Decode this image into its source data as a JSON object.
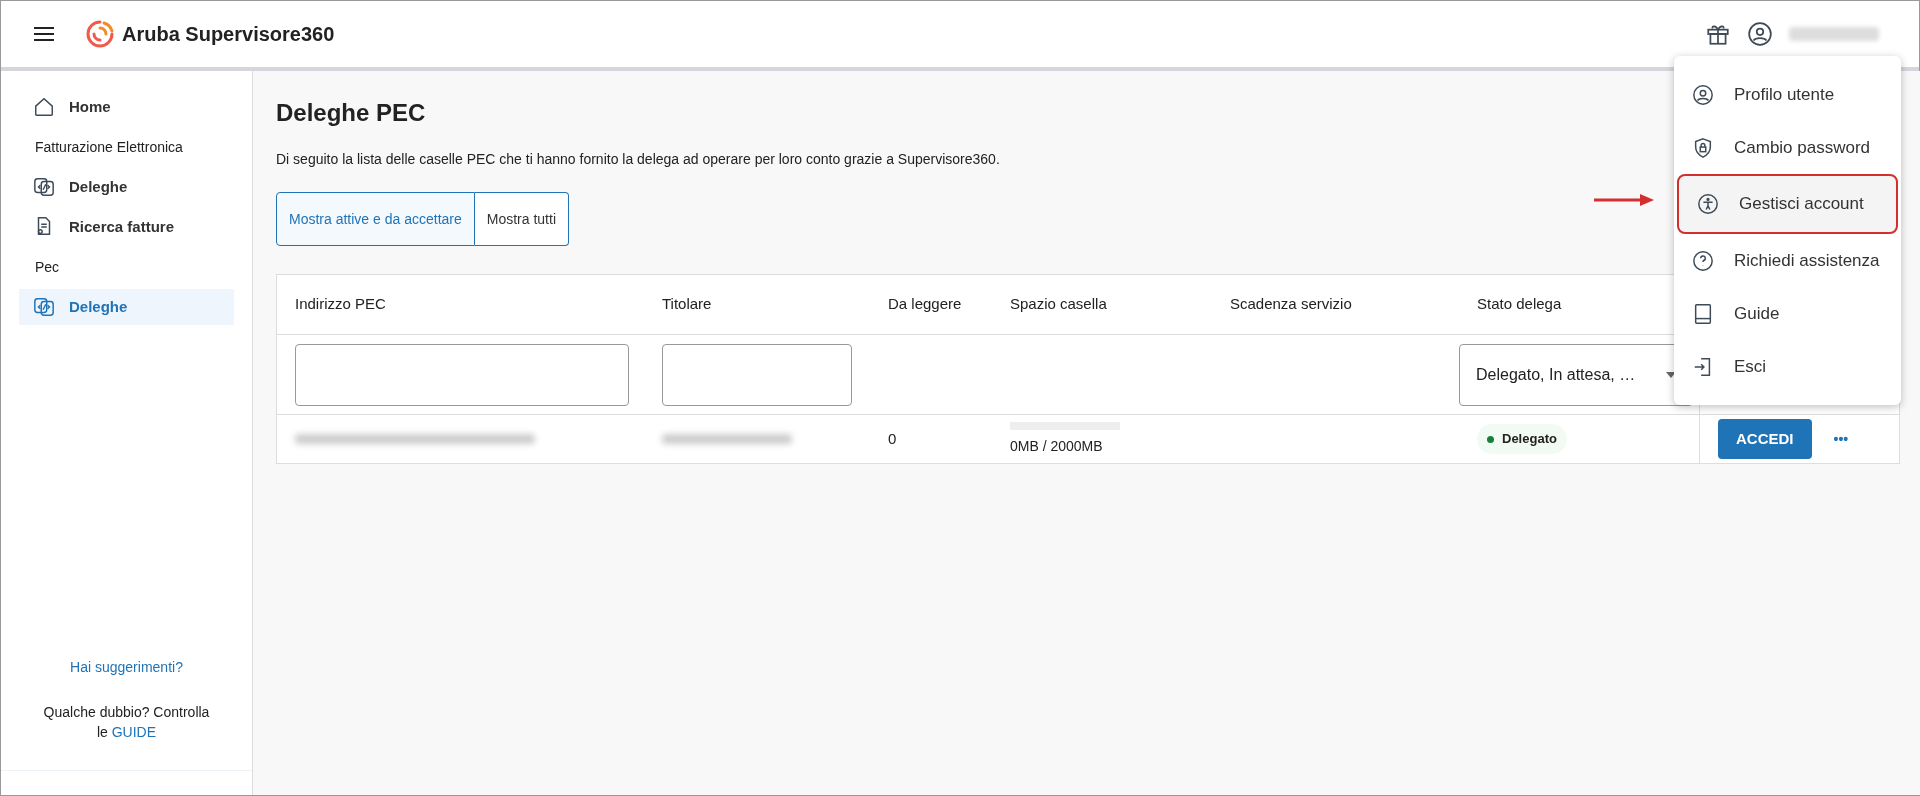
{
  "header": {
    "app_name": "Aruba Supervisore360"
  },
  "sidebar": {
    "items": [
      {
        "kind": "link",
        "label": "Home",
        "selected": false
      },
      {
        "kind": "section",
        "label": "Fatturazione Elettronica"
      },
      {
        "kind": "link",
        "label": "Deleghe",
        "selected": false
      },
      {
        "kind": "link",
        "label": "Ricerca fatture",
        "selected": false
      },
      {
        "kind": "section",
        "label": "Pec"
      },
      {
        "kind": "link",
        "label": "Deleghe",
        "selected": true
      }
    ],
    "feedback_link": "Hai suggerimenti?",
    "help_text": "Qualche dubbio? Controlla le",
    "help_link": "GUIDE"
  },
  "page": {
    "title": "Deleghe PEC",
    "description": "Di seguito la lista delle caselle PEC che ti hanno fornito la delega ad operare per loro conto grazie a Supervisore360.",
    "filters": [
      {
        "label": "Mostra attive e da accettare",
        "selected": true
      },
      {
        "label": "Mostra tutti",
        "selected": false
      }
    ]
  },
  "table": {
    "columns": [
      "Indirizzo PEC",
      "Titolare",
      "Da leggere",
      "Spazio casella",
      "Scadenza servizio",
      "Stato delega"
    ],
    "status_filter": "Delegato, In attesa, …",
    "rows": [
      {
        "unread": "0",
        "space": {
          "level": 0,
          "reading": "0MB / 2000MB"
        },
        "status": {
          "label": "Delegato",
          "color": "#15803d"
        },
        "action": "ACCEDI",
        "more": "•••"
      }
    ]
  },
  "user_menu": {
    "items": [
      {
        "label": "Profilo utente",
        "highlighted": false
      },
      {
        "label": "Cambio password",
        "highlighted": false
      },
      {
        "label": "Gestisci account",
        "highlighted": true
      },
      {
        "label": "Richiedi assistenza",
        "highlighted": false
      },
      {
        "label": "Guide",
        "highlighted": false
      },
      {
        "label": "Esci",
        "highlighted": false
      }
    ]
  }
}
